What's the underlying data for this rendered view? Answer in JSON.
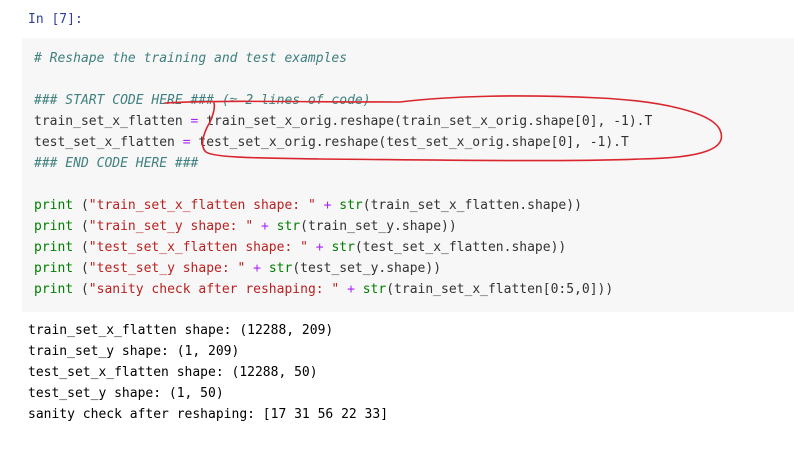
{
  "cell": {
    "prompt": "In [7]:",
    "code": {
      "l1": "# Reshape the training and test examples",
      "l3": "### START CODE HERE ### (≈ 2 lines of code)",
      "l4": {
        "a": "train_set_x_flatten ",
        "op": "=",
        "b": " train_set_x_orig.reshape(train_set_x_orig.shape[0], -1).T"
      },
      "l5": {
        "a": "test_set_x_flatten ",
        "op": "=",
        "b": " test_set_x_orig.reshape(test_set_x_orig.shape[0], -1).T"
      },
      "l6": "### END CODE HERE ###",
      "p1": {
        "kw": "print",
        "s": "\"train_set_x_flatten shape: \"",
        "rest": "train_set_x_flatten.shape))"
      },
      "p2": {
        "kw": "print",
        "s": "\"train_set_y shape: \"",
        "rest": "train_set_y.shape))"
      },
      "p3": {
        "kw": "print",
        "s": "\"test_set_x_flatten shape: \"",
        "rest": "test_set_x_flatten.shape))"
      },
      "p4": {
        "kw": "print",
        "s": "\"test_set_y shape: \"",
        "rest": "test_set_y.shape))"
      },
      "p5": {
        "kw": "print",
        "s": "\"sanity check after reshaping: \"",
        "rest": "train_set_x_flatten[0:5,0]))"
      },
      "open": " (",
      "plus": " + ",
      "str": "str",
      "paren": "("
    },
    "output": [
      "train_set_x_flatten shape: (12288, 209)",
      "train_set_y shape: (1, 209)",
      "test_set_x_flatten shape: (12288, 50)",
      "test_set_y shape: (1, 50)",
      "sanity check after reshaping: [17 31 56 22 33]"
    ],
    "annotation_color": "#d9262c"
  }
}
